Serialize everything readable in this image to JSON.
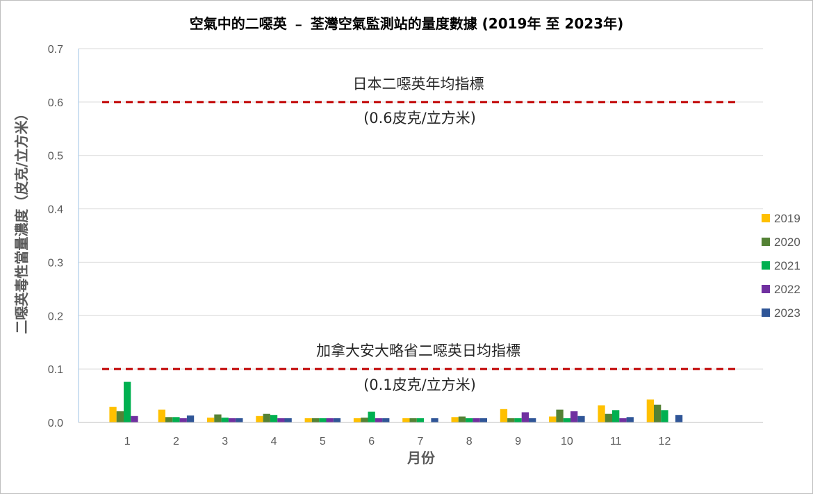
{
  "chart_data": {
    "type": "bar",
    "title": "空氣中的二噁英 ﹣ 荃灣空氣監測站的量度數據 (2019年 至 2023年)",
    "xlabel": "月份",
    "ylabel": "二噁英毒性當量濃度（皮克/立方米）",
    "categories": [
      "1",
      "2",
      "3",
      "4",
      "5",
      "6",
      "7",
      "8",
      "9",
      "10",
      "11",
      "12"
    ],
    "ylim": [
      0,
      0.7
    ],
    "yticks": [
      "0.0",
      "0.1",
      "0.2",
      "0.3",
      "0.4",
      "0.5",
      "0.6",
      "0.7"
    ],
    "grid": true,
    "legend_position": "right",
    "series": [
      {
        "name": "2019",
        "color": "#FFC000",
        "values": [
          0.029,
          0.024,
          0.009,
          0.012,
          0.008,
          0.008,
          0.008,
          0.01,
          0.025,
          0.011,
          0.032,
          0.043
        ]
      },
      {
        "name": "2020",
        "color": "#548235",
        "values": [
          0.021,
          0.01,
          0.015,
          0.016,
          0.008,
          0.009,
          0.008,
          0.011,
          0.008,
          0.024,
          0.016,
          0.033
        ]
      },
      {
        "name": "2021",
        "color": "#00B050",
        "values": [
          0.076,
          0.01,
          0.009,
          0.014,
          0.008,
          0.02,
          0.008,
          0.008,
          0.008,
          0.008,
          0.023,
          0.023
        ]
      },
      {
        "name": "2022",
        "color": "#7030A0",
        "values": [
          0.012,
          0.008,
          0.008,
          0.008,
          0.008,
          0.008,
          null,
          0.008,
          0.019,
          0.021,
          0.008,
          null
        ]
      },
      {
        "name": "2023",
        "color": "#2F5597",
        "values": [
          null,
          0.013,
          0.008,
          0.008,
          0.008,
          0.008,
          0.008,
          0.008,
          0.008,
          0.012,
          0.01,
          0.014
        ]
      }
    ],
    "reference_lines": [
      {
        "value": 0.6,
        "label1": "日本二噁英年均指標",
        "label2": "(0.6皮克/立方米)",
        "color": "#C00000"
      },
      {
        "value": 0.1,
        "label1": "加拿大安大略省二噁英日均指標",
        "label2": "(0.1皮克/立方米)",
        "color": "#C00000"
      }
    ]
  }
}
